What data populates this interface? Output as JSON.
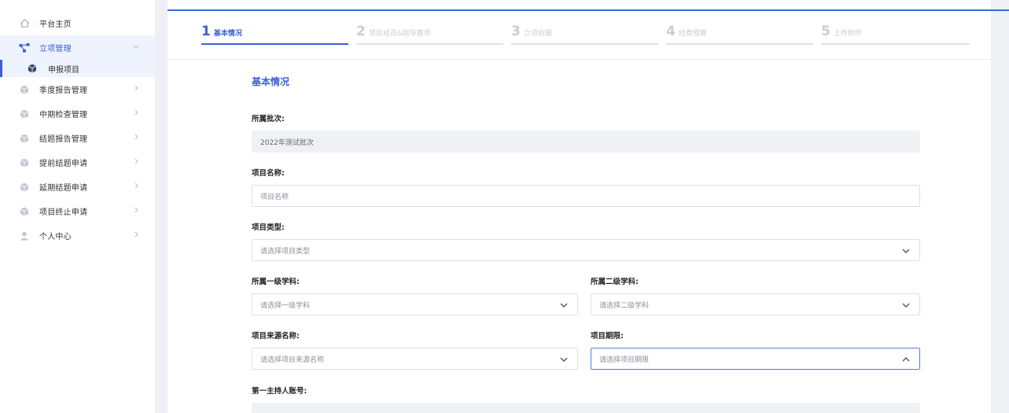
{
  "sidebar": {
    "items": [
      {
        "label": "平台主页",
        "icon": "home-icon"
      },
      {
        "label": "立项管理",
        "icon": "tree-icon"
      },
      {
        "label": "申报项目",
        "icon": "cube-icon"
      },
      {
        "label": "季度报告管理",
        "icon": "cube-icon"
      },
      {
        "label": "中期检查管理",
        "icon": "cube-icon"
      },
      {
        "label": "结题报告管理",
        "icon": "cube-icon"
      },
      {
        "label": "提前结题申请",
        "icon": "cube-icon"
      },
      {
        "label": "延期结题申请",
        "icon": "cube-icon"
      },
      {
        "label": "项目终止申请",
        "icon": "cube-icon"
      },
      {
        "label": "个人中心",
        "icon": "user-icon"
      }
    ]
  },
  "steps": [
    {
      "num": "1",
      "label": "基本情况"
    },
    {
      "num": "2",
      "label": "项目成员&指导教师"
    },
    {
      "num": "3",
      "label": "立项依据"
    },
    {
      "num": "4",
      "label": "经费预算"
    },
    {
      "num": "5",
      "label": "上传附件"
    }
  ],
  "form": {
    "section_title": "基本情况",
    "batch": {
      "label": "所属批次:",
      "value": "2022年测试批次"
    },
    "name": {
      "label": "项目名称:",
      "placeholder": "项目名称"
    },
    "type": {
      "label": "项目类型:",
      "placeholder": "请选择项目类型"
    },
    "subject1": {
      "label": "所属一级学科:",
      "placeholder": "请选择一级学科"
    },
    "subject2": {
      "label": "所属二级学科:",
      "placeholder": "请选择二级学科"
    },
    "source": {
      "label": "项目来源名称:",
      "placeholder": "请选择项目来源名称"
    },
    "period": {
      "label": "项目期限:",
      "placeholder": "请选择项目期限"
    },
    "host": {
      "label": "第一主持人账号:"
    }
  },
  "colors": {
    "accent": "#3a5fd9",
    "gutter": "#eef0f5"
  }
}
